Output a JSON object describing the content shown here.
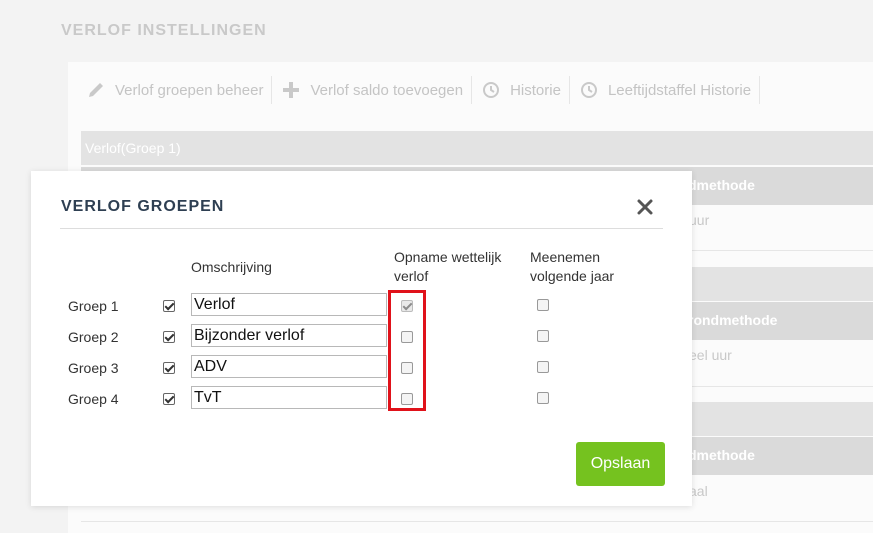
{
  "page": {
    "title": "VERLOF INSTELLINGEN"
  },
  "toolbar": {
    "items": [
      {
        "label": "Verlof groepen beheer",
        "icon": "pencil-icon"
      },
      {
        "label": "Verlof saldo toevoegen",
        "icon": "plus-icon"
      },
      {
        "label": "Historie",
        "icon": "history-icon"
      },
      {
        "label": "Leeftijdstaffel Historie",
        "icon": "history-icon"
      }
    ]
  },
  "background": {
    "group_label": "Verlof(Groep 1)",
    "headers": [
      "dmethode",
      "rondmethode",
      "dmethode"
    ],
    "values": [
      "uur",
      "eel uur",
      "aal"
    ]
  },
  "modal": {
    "title": "VERLOF GROEPEN",
    "columns": {
      "description": "Omschrijving",
      "statutory": "Opname wettelijk verlof",
      "carry_over": "Meenemen volgende jaar"
    },
    "rows": [
      {
        "name": "Groep 1",
        "enabled": true,
        "description": "Verlof",
        "statutory": true,
        "statutory_disabled": true,
        "carry_over": false
      },
      {
        "name": "Groep 2",
        "enabled": true,
        "description": "Bijzonder verlof",
        "statutory": false,
        "statutory_disabled": false,
        "carry_over": false
      },
      {
        "name": "Groep 3",
        "enabled": true,
        "description": "ADV",
        "statutory": false,
        "statutory_disabled": false,
        "carry_over": false
      },
      {
        "name": "Groep 4",
        "enabled": true,
        "description": "TvT",
        "statutory": false,
        "statutory_disabled": false,
        "carry_over": false
      }
    ],
    "save_label": "Opslaan"
  },
  "colors": {
    "accent": "#75c21f",
    "title": "#2e3f52",
    "highlight": "#e0121a"
  }
}
